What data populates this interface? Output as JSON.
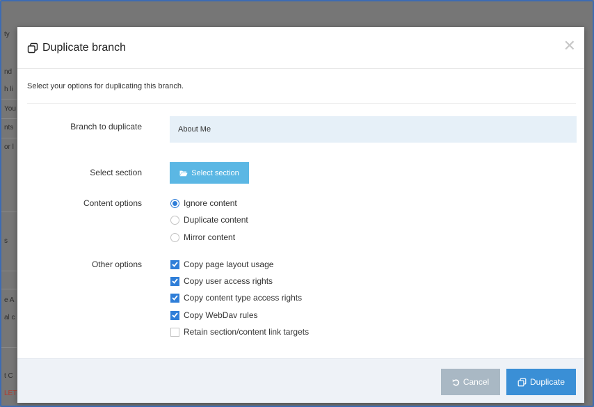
{
  "background": {
    "fragments": [
      "ty",
      "nd",
      "h li",
      "You",
      "nts",
      "or l",
      "s",
      "e A",
      "al c",
      "t C",
      "LET"
    ]
  },
  "modal": {
    "title": "Duplicate branch",
    "title_icon": "duplicate-icon",
    "close_icon": "close-icon",
    "intro": "Select your options for duplicating this branch."
  },
  "form": {
    "branch_label": "Branch to duplicate",
    "branch_value": "About Me",
    "section_label": "Select section",
    "section_button": "Select section",
    "section_button_icon": "folder-open-icon",
    "content_label": "Content options",
    "content_options": [
      {
        "label": "Ignore content",
        "selected": true
      },
      {
        "label": "Duplicate content",
        "selected": false
      },
      {
        "label": "Mirror content",
        "selected": false
      }
    ],
    "other_label": "Other options",
    "other_options": [
      {
        "label": "Copy page layout usage",
        "checked": true
      },
      {
        "label": "Copy user access rights",
        "checked": true
      },
      {
        "label": "Copy content type access rights",
        "checked": true
      },
      {
        "label": "Copy WebDav rules",
        "checked": true
      },
      {
        "label": "Retain section/content link targets",
        "checked": false
      }
    ]
  },
  "footer": {
    "cancel_label": "Cancel",
    "cancel_icon": "undo-icon",
    "duplicate_label": "Duplicate",
    "duplicate_icon": "duplicate-icon"
  },
  "colors": {
    "accent": "#3a8fd6",
    "select_button": "#5bb7e4",
    "cancel_button": "#a9b8c4",
    "field_bg": "#e6f0f8"
  }
}
